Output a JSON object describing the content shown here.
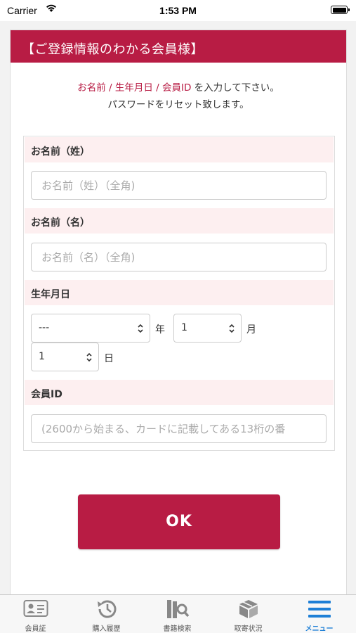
{
  "status_bar": {
    "carrier": "Carrier",
    "time": "1:53 PM"
  },
  "header": {
    "title": "【ご登録情報のわかる会員様】"
  },
  "intro": {
    "emphasis": "お名前 / 生年月日 / 会員ID",
    "line1_suffix": " を入力して下さい。",
    "line2": "パスワードをリセット致します。"
  },
  "form": {
    "last_name": {
      "label": "お名前（姓）",
      "placeholder": "お名前（姓）（全角)",
      "value": ""
    },
    "first_name": {
      "label": "お名前（名）",
      "placeholder": "お名前（名）（全角)",
      "value": ""
    },
    "birthdate": {
      "label": "生年月日",
      "year_value": "---",
      "year_unit": "年",
      "month_value": "1",
      "month_unit": "月",
      "day_value": "1",
      "day_unit": "日"
    },
    "member_id": {
      "label": "会員ID",
      "placeholder": "(2600から始まる、カードに記載してある13桁の番",
      "value": ""
    }
  },
  "ok_button": {
    "label": "OK"
  },
  "tab_bar": {
    "accent_color": "#1e7fd6",
    "items": [
      {
        "label": "会員証",
        "icon": "member-card-icon",
        "active": false
      },
      {
        "label": "購入履歴",
        "icon": "history-icon",
        "active": false
      },
      {
        "label": "書籍検索",
        "icon": "book-search-icon",
        "active": false
      },
      {
        "label": "取寄状況",
        "icon": "order-status-icon",
        "active": false
      },
      {
        "label": "メニュー",
        "icon": "menu-icon",
        "active": true
      }
    ]
  },
  "colors": {
    "brand": "#b81c44",
    "label_background": "#fdeff0"
  }
}
